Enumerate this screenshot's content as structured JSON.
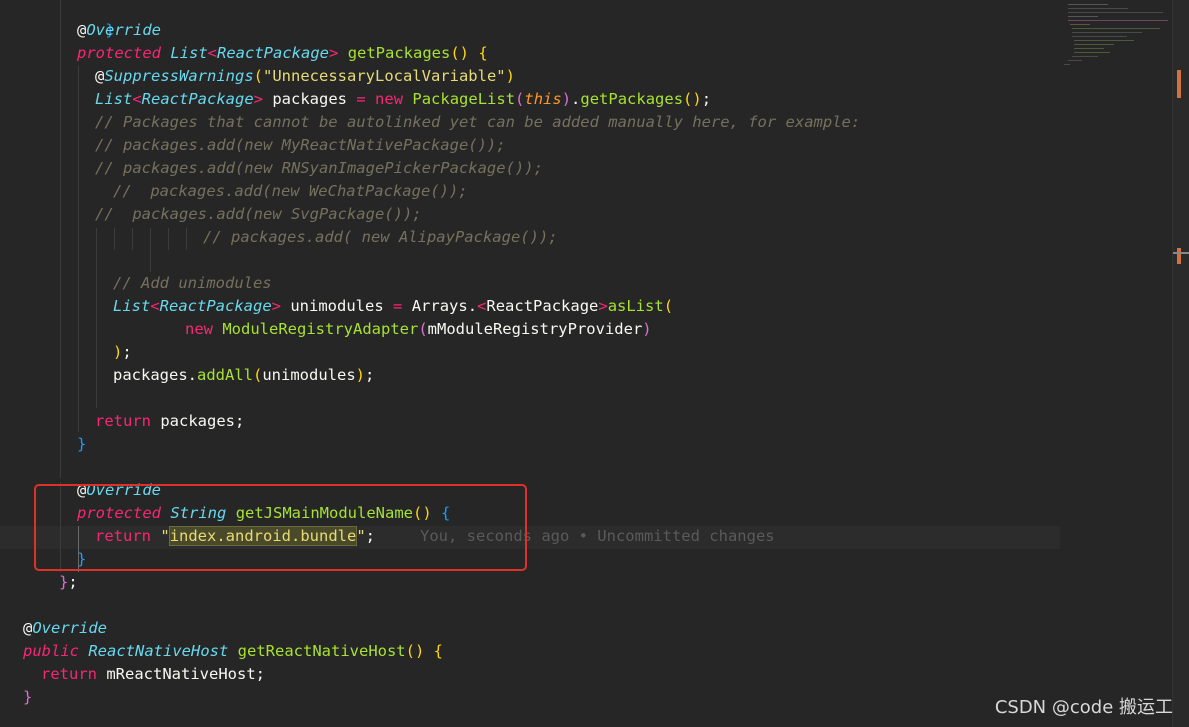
{
  "editor": {
    "blame": "You, seconds ago • Uncommitted changes",
    "watermark": "CSDN @code 搬运工",
    "highlight_color": "#e0302a"
  },
  "code": {
    "l0": "}",
    "l1_at": "@",
    "l1_anno": "Override",
    "l2_kw": "protected",
    "l2_type1": "List",
    "l2_lt": "<",
    "l2_type2": "ReactPackage",
    "l2_gt": ">",
    "l2_fn": "getPackages",
    "l2_par": "()",
    "l2_brace": "{",
    "l3_at": "@",
    "l3_anno": "SuppressWarnings",
    "l3_p1": "(",
    "l3_str": "\"UnnecessaryLocalVariable\"",
    "l3_p2": ")",
    "l4_type1": "List",
    "l4_lt": "<",
    "l4_type2": "ReactPackage",
    "l4_gt": ">",
    "l4_var": "packages",
    "l4_eq": "=",
    "l4_new": "new",
    "l4_cls": "PackageList",
    "l4_p1": "(",
    "l4_this": "this",
    "l4_p2": ")",
    "l4_dot": ".",
    "l4_fn": "getPackages",
    "l4_par": "()",
    "l4_semi": ";",
    "l5": "// Packages that cannot be autolinked yet can be added manually here, for example:",
    "l6": "// packages.add(new MyReactNativePackage());",
    "l7": "// packages.add(new RNSyanImagePickerPackage());",
    "l8": "//  packages.add(new WeChatPackage());",
    "l9": "//  packages.add(new SvgPackage());",
    "l10": "// packages.add( new AlipayPackage());",
    "l12": "// Add unimodules",
    "l13_type1": "List",
    "l13_lt": "<",
    "l13_type2": "ReactPackage",
    "l13_gt": ">",
    "l13_var": "unimodules",
    "l13_eq": "=",
    "l13_cls": "Arrays",
    "l13_dot": ".",
    "l13_lt2": "<",
    "l13_gen": "ReactPackage",
    "l13_gt2": ">",
    "l13_fn": "asList",
    "l13_p": "(",
    "l14_new": "new",
    "l14_cls": "ModuleRegistryAdapter",
    "l14_p1": "(",
    "l14_arg": "mModuleRegistryProvider",
    "l14_p2": ")",
    "l15_p": ")",
    "l15_semi": ";",
    "l16_var": "packages",
    "l16_dot": ".",
    "l16_fn": "addAll",
    "l16_p1": "(",
    "l16_arg": "unimodules",
    "l16_p2": ")",
    "l16_semi": ";",
    "l18_kw": "return",
    "l18_var": "packages",
    "l18_semi": ";",
    "l19": "}",
    "l21_at": "@",
    "l21_anno": "Override",
    "l22_kw": "protected",
    "l22_type": "String",
    "l22_fn": "getJSMainModuleName",
    "l22_par": "()",
    "l22_brace": "{",
    "l23_kw": "return",
    "l23_q1": "\"",
    "l23_str": "index.android.bundle",
    "l23_q2": "\"",
    "l23_semi": ";",
    "l24": "}",
    "l25_brace": "}",
    "l25_semi": ";",
    "l27_at": "@",
    "l27_anno": "Override",
    "l28_kw": "public",
    "l28_type": "ReactNativeHost",
    "l28_fn": "getReactNativeHost",
    "l28_par": "()",
    "l28_brace": "{",
    "l29_kw": "return",
    "l29_var": "mReactNativeHost",
    "l29_semi": ";",
    "l30": "}"
  }
}
